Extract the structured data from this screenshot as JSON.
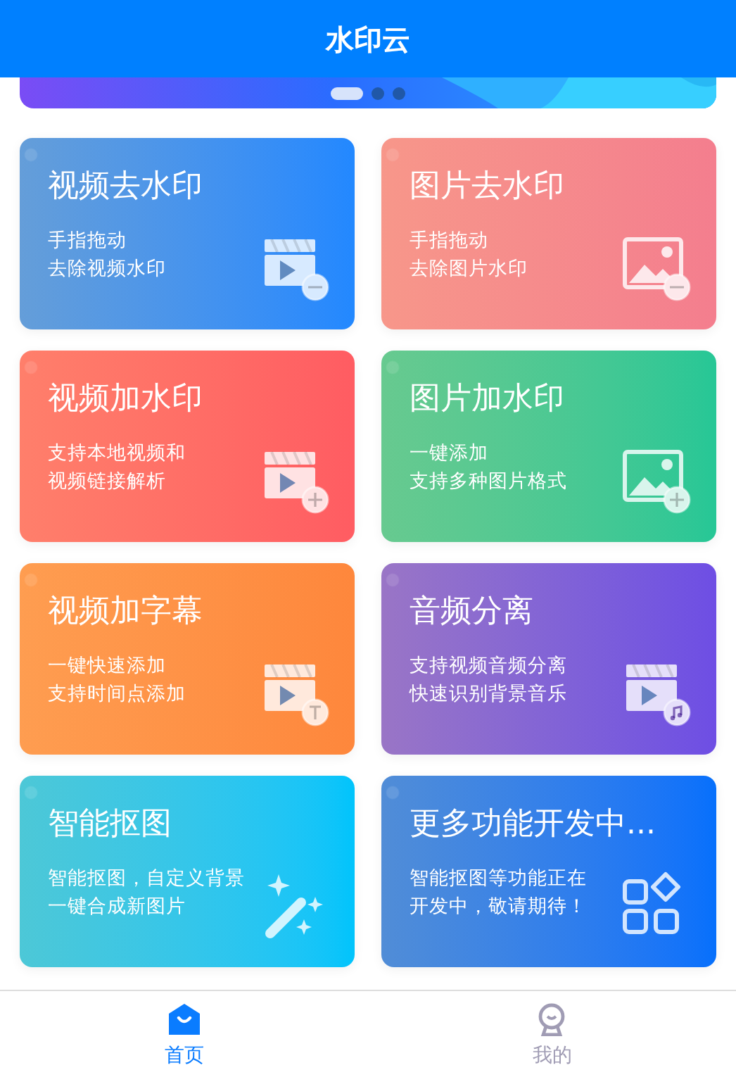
{
  "header": {
    "title": "水印云"
  },
  "banner": {
    "slides": [
      {
        "selected": true
      },
      {
        "selected": false
      },
      {
        "selected": false
      }
    ]
  },
  "cards": [
    {
      "title": "视频去水印",
      "lines": [
        "手指拖动",
        "去除视频水印"
      ],
      "color": "#2288ff",
      "kind": "video-minus"
    },
    {
      "title": "图片去水印",
      "lines": [
        "手指拖动",
        "去除图片水印"
      ],
      "color": "#f47e8e",
      "kind": "image-minus"
    },
    {
      "title": "视频加水印",
      "lines": [
        "支持本地视频和",
        "视频链接解析"
      ],
      "color": "#ff5c62",
      "kind": "video-plus"
    },
    {
      "title": "图片加水印",
      "lines": [
        "一键添加",
        "支持多种图片格式"
      ],
      "color": "#26c796",
      "kind": "image-plus"
    },
    {
      "title": "视频加字幕",
      "lines": [
        "一键快速添加",
        "支持时间点添加"
      ],
      "color": "#fe873c",
      "kind": "video-text"
    },
    {
      "title": "音频分离",
      "lines": [
        "支持视频音频分离",
        "快速识别背景音乐"
      ],
      "color": "#6e4ee4",
      "kind": "video-music"
    },
    {
      "title": "智能抠图",
      "lines": [
        "智能抠图，自定义背景",
        "一键合成新图片"
      ],
      "color": "#00c4fc",
      "kind": "wand"
    },
    {
      "title": "更多功能开发中...",
      "lines": [
        "智能抠图等功能正在",
        "开发中，敬请期待！"
      ],
      "color": "#0670fc",
      "kind": "grid"
    }
  ],
  "tabs": [
    {
      "label": "首页",
      "kind": "home",
      "selected": true
    },
    {
      "label": "我的",
      "kind": "person",
      "selected": false
    }
  ]
}
